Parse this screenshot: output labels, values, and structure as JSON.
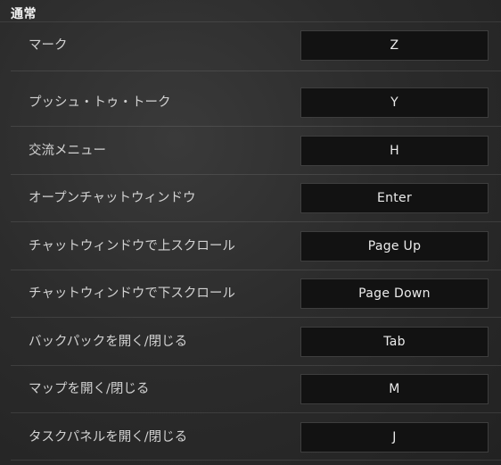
{
  "section": {
    "title": "通常"
  },
  "bindings": [
    {
      "label": "マーク",
      "key": "Z"
    },
    {
      "label": "プッシュ・トゥ・トーク",
      "key": "Y"
    },
    {
      "label": "交流メニュー",
      "key": "H"
    },
    {
      "label": "オープンチャットウィンドウ",
      "key": "Enter"
    },
    {
      "label": "チャットウィンドウで上スクロール",
      "key": "Page Up"
    },
    {
      "label": "チャットウィンドウで下スクロール",
      "key": "Page Down"
    },
    {
      "label": "バックパックを開く/閉じる",
      "key": "Tab"
    },
    {
      "label": "マップを開く/閉じる",
      "key": "M"
    },
    {
      "label": "タスクパネルを開く/閉じる",
      "key": "J"
    }
  ]
}
